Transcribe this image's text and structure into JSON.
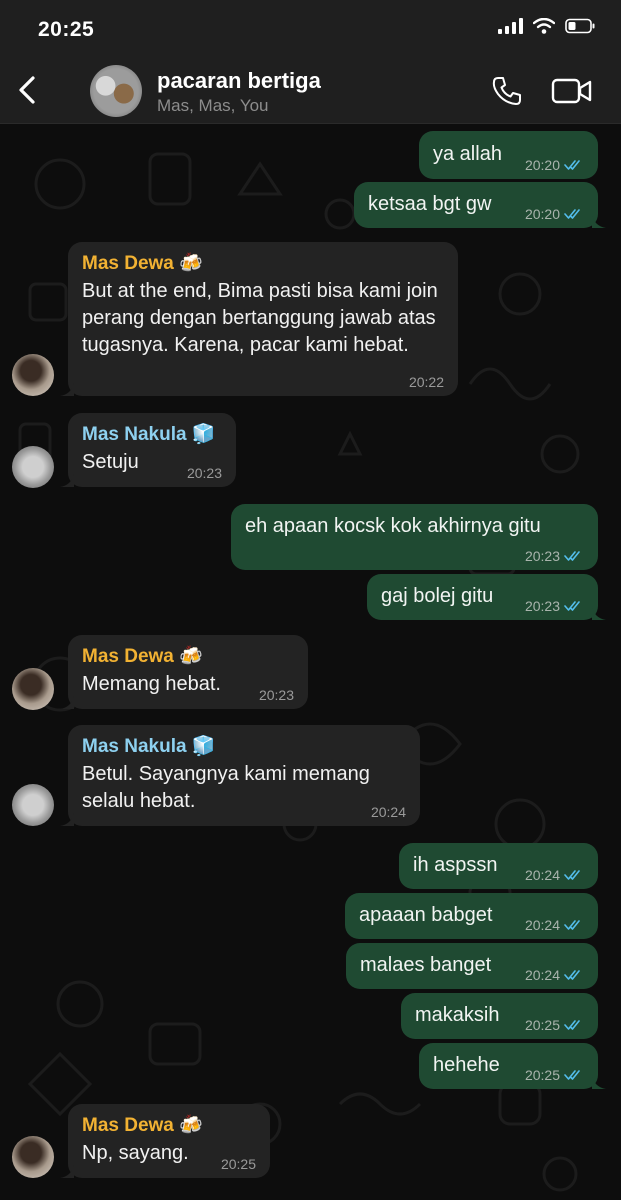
{
  "status_bar": {
    "time": "20:25"
  },
  "header": {
    "title": "pacaran bertiga",
    "subtitle": "Mas, Mas, You"
  },
  "messages": [
    {
      "direction": "out",
      "text": "ya allah",
      "time": "20:20",
      "read": true
    },
    {
      "direction": "out",
      "text": "ketsaa bgt gw",
      "time": "20:20",
      "read": true
    },
    {
      "direction": "in",
      "sender": "Mas Dewa",
      "sender_emoji": "🍻",
      "text": "But at the end, Bima pasti bisa kami join perang dengan bertanggung jawab atas tugasnya. Karena, pacar kami hebat.",
      "time": "20:22"
    },
    {
      "direction": "in",
      "sender": "Mas Nakula",
      "sender_emoji": "🧊",
      "text": "Setuju",
      "time": "20:23"
    },
    {
      "direction": "out",
      "text": "eh apaan kocsk kok akhirnya gitu",
      "time": "20:23",
      "read": true
    },
    {
      "direction": "out",
      "text": "gaj bolej gitu",
      "time": "20:23",
      "read": true
    },
    {
      "direction": "in",
      "sender": "Mas Dewa",
      "sender_emoji": "🍻",
      "text": "Memang hebat.",
      "time": "20:23"
    },
    {
      "direction": "in",
      "sender": "Mas Nakula",
      "sender_emoji": "🧊",
      "text": "Betul. Sayangnya kami memang selalu hebat.",
      "time": "20:24"
    },
    {
      "direction": "out",
      "text": "ih aspssn",
      "time": "20:24",
      "read": true
    },
    {
      "direction": "out",
      "text": "apaaan babget",
      "time": "20:24",
      "read": true
    },
    {
      "direction": "out",
      "text": "malaes banget",
      "time": "20:24",
      "read": true
    },
    {
      "direction": "out",
      "text": "makaksih",
      "time": "20:25",
      "read": true
    },
    {
      "direction": "out",
      "text": "hehehe",
      "time": "20:25",
      "read": true
    },
    {
      "direction": "in",
      "sender": "Mas Dewa",
      "sender_emoji": "🍻",
      "text": "Np, sayang.",
      "time": "20:25"
    }
  ],
  "colors": {
    "outgoing_bubble": "#1f4a32",
    "incoming_bubble": "#232323",
    "read_tick": "#53bdeb",
    "sender_dewa": "#f2b233",
    "sender_nakula": "#8ed1f0"
  }
}
